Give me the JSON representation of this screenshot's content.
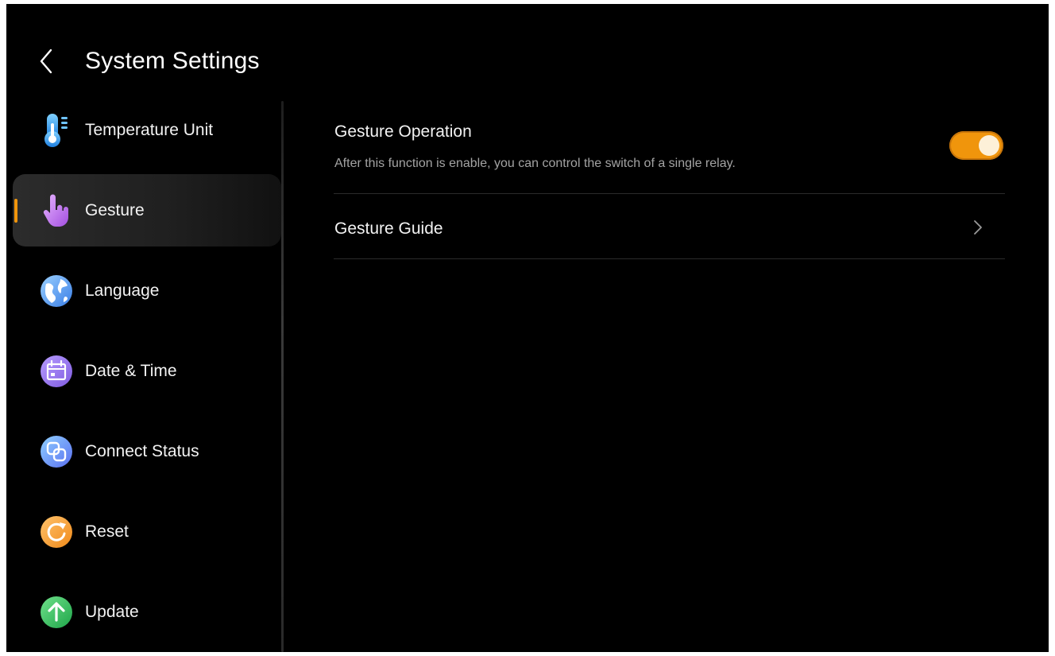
{
  "header": {
    "title": "System Settings",
    "back_icon": "chevron-left-icon"
  },
  "sidebar": {
    "items": [
      {
        "label": "Temperature Unit",
        "icon": "thermometer-icon",
        "active": false
      },
      {
        "label": "Gesture",
        "icon": "hand-pointer-icon",
        "active": true
      },
      {
        "label": "Language",
        "icon": "globe-icon",
        "active": false
      },
      {
        "label": "Date & Time",
        "icon": "calendar-icon",
        "active": false
      },
      {
        "label": "Connect Status",
        "icon": "link-squares-icon",
        "active": false
      },
      {
        "label": "Reset",
        "icon": "reset-icon",
        "active": false
      },
      {
        "label": "Update",
        "icon": "arrow-up-icon",
        "active": false
      }
    ]
  },
  "content": {
    "gesture_operation": {
      "title": "Gesture Operation",
      "description": "After this function is enable, you can control the switch of a single relay.",
      "enabled": true
    },
    "gesture_guide": {
      "title": "Gesture Guide"
    }
  },
  "colors": {
    "accent": "#f0950c",
    "background": "#000000",
    "text": "#f2f2f2",
    "subtext": "#a3a3a3"
  }
}
